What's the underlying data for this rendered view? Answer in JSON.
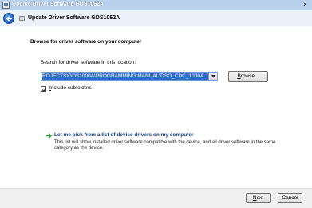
{
  "window": {
    "title": "Update Driver Software GDS1062A",
    "close_label": "×"
  },
  "nav": {
    "title": "Update Driver Software GDS1062A"
  },
  "main": {
    "heading": "Browse for driver software on your computer",
    "search_label": "Search for driver software in this location:",
    "path_value": "ROJECTS\\GDS1000A\\PROGRAMMING MANUAL\\DSO_CDC_1000A",
    "browse": {
      "accel": "B",
      "rest": "rowse..."
    },
    "include_subfolders": {
      "checked": true,
      "accel": "I",
      "rest": "nclude subfolders"
    },
    "pick": {
      "title": "Let me pick from a list of device drivers on my computer",
      "description": "This list will show installed driver software compatible with the device, and all driver software in the same category as the device."
    }
  },
  "footer": {
    "next": {
      "accel": "N",
      "rest": "ext"
    },
    "cancel_label": "Cancel"
  },
  "colors": {
    "titlebar": "#b9d1ea",
    "selection": "#316ac5",
    "link": "#0f3f86",
    "arrow": "#3aa041"
  },
  "icons": [
    "app-icon",
    "back-arrow-icon",
    "driver-icon",
    "dropdown-arrow-icon",
    "checkmark-icon",
    "green-arrow-icon",
    "close-icon"
  ]
}
